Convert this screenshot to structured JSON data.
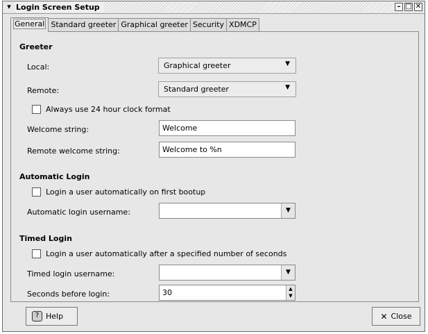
{
  "window": {
    "title": "Login Screen Setup"
  },
  "tabs": [
    "General",
    "Standard greeter",
    "Graphical greeter",
    "Security",
    "XDMCP"
  ],
  "greeter": {
    "section": "Greeter",
    "local_label": "Local:",
    "local_value": "Graphical greeter",
    "remote_label": "Remote:",
    "remote_value": "Standard greeter",
    "clock_label": "Always use 24 hour clock format",
    "welcome_label": "Welcome string:",
    "welcome_value": "Welcome",
    "remote_welcome_label": "Remote welcome string:",
    "remote_welcome_value": "Welcome to %n"
  },
  "automatic": {
    "section": "Automatic Login",
    "check_label": "Login a user automatically on first bootup",
    "username_label": "Automatic login username:",
    "username_value": ""
  },
  "timed": {
    "section": "Timed Login",
    "check_label": "Login a user automatically after a specified number of seconds",
    "username_label": "Timed login username:",
    "username_value": "",
    "seconds_label": "Seconds before login:",
    "seconds_value": "30"
  },
  "buttons": {
    "help": "Help",
    "close": "Close"
  },
  "icons": {
    "menu": "chevron-down-icon",
    "minimize": "minimize-icon",
    "maximize": "maximize-icon",
    "close": "close-icon",
    "help": "help-icon",
    "close_button": "x-icon"
  }
}
